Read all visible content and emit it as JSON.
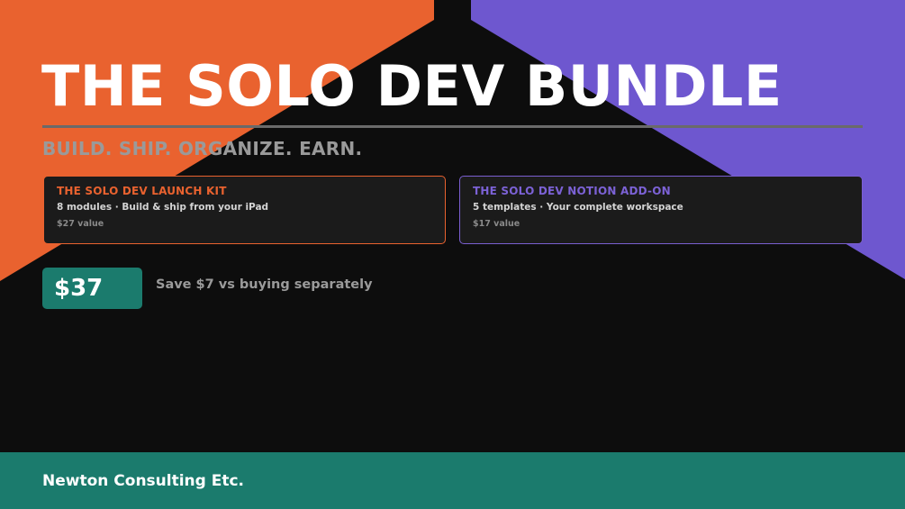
{
  "hero": {
    "title": "THE SOLO DEV BUNDLE",
    "subtitle": "BUILD. SHIP. ORGANIZE. EARN."
  },
  "products": [
    {
      "title": "THE SOLO DEV LAUNCH KIT",
      "description": "8 modules · Build & ship from your iPad",
      "value": "$27 value",
      "accent": "#e9622f"
    },
    {
      "title": "THE SOLO DEV NOTION ADD-ON",
      "description": "5 templates · Your complete workspace",
      "value": "$17 value",
      "accent": "#7c62d6"
    }
  ],
  "pricing": {
    "price": "$37",
    "savings": "Save $7 vs buying separately"
  },
  "footer": {
    "brand": "Newton Consulting Etc."
  },
  "colors": {
    "orange": "#e9622f",
    "purple": "#6e57cf",
    "teal": "#1b7b6d",
    "background": "#0d0d0d"
  }
}
